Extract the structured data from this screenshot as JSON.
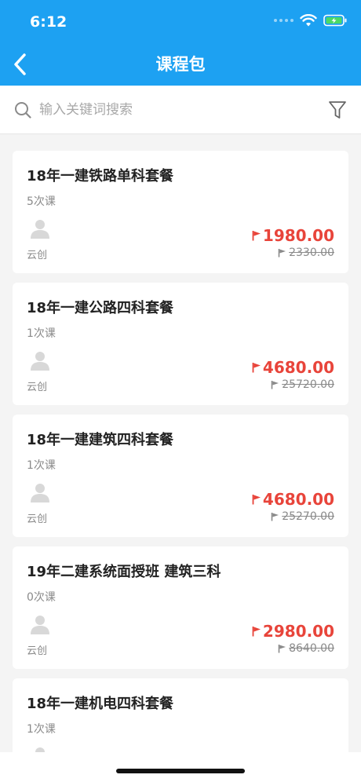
{
  "status": {
    "time": "6:12"
  },
  "nav": {
    "title": "课程包"
  },
  "search": {
    "placeholder": "输入关键词搜索"
  },
  "courses": [
    {
      "title": "18年一建铁路单科套餐",
      "lessons": "5次课",
      "author": "云创",
      "price": "1980.00",
      "original_price": "2330.00"
    },
    {
      "title": "18年一建公路四科套餐",
      "lessons": "1次课",
      "author": "云创",
      "price": "4680.00",
      "original_price": "25720.00"
    },
    {
      "title": "18年一建建筑四科套餐",
      "lessons": "1次课",
      "author": "云创",
      "price": "4680.00",
      "original_price": "25270.00"
    },
    {
      "title": "19年二建系统面授班 建筑三科",
      "lessons": "0次课",
      "author": "云创",
      "price": "2980.00",
      "original_price": "8640.00"
    },
    {
      "title": "18年一建机电四科套餐",
      "lessons": "1次课",
      "author": "",
      "price": "",
      "original_price": ""
    }
  ],
  "colors": {
    "accent": "#1da1f2",
    "price": "#e8443a",
    "muted": "#8a8a8a"
  },
  "icons": {
    "back": "chevron-left-icon",
    "search": "search-icon",
    "filter": "filter-icon",
    "avatar": "user-avatar-icon",
    "flag": "flag-icon"
  }
}
